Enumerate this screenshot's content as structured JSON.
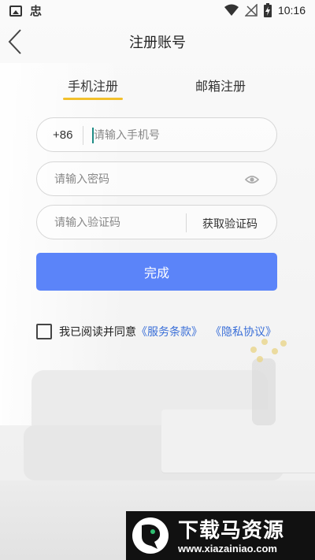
{
  "status_bar": {
    "app_glyph": "忠",
    "time": "10:16"
  },
  "header": {
    "title": "注册账号"
  },
  "tabs": [
    {
      "label": "手机注册",
      "active": true
    },
    {
      "label": "邮箱注册",
      "active": false
    }
  ],
  "form": {
    "phone": {
      "prefix": "+86",
      "placeholder": "请输入手机号",
      "value": ""
    },
    "password": {
      "placeholder": "请输入密码",
      "value": ""
    },
    "code": {
      "placeholder": "请输入验证码",
      "value": "",
      "get_code_label": "获取验证码"
    },
    "submit_label": "完成"
  },
  "agreement": {
    "checked": false,
    "text": "我已阅读并同意",
    "terms_link": "《服务条款》",
    "privacy_link": "《隐私协议》"
  },
  "watermark": {
    "title": "下载马资源",
    "url": "www.xiazainiao.com"
  },
  "colors": {
    "accent": "#5b84f9",
    "tab_indicator": "#f2c02b",
    "link": "#3a6fd8",
    "caret": "#1e8c85"
  }
}
